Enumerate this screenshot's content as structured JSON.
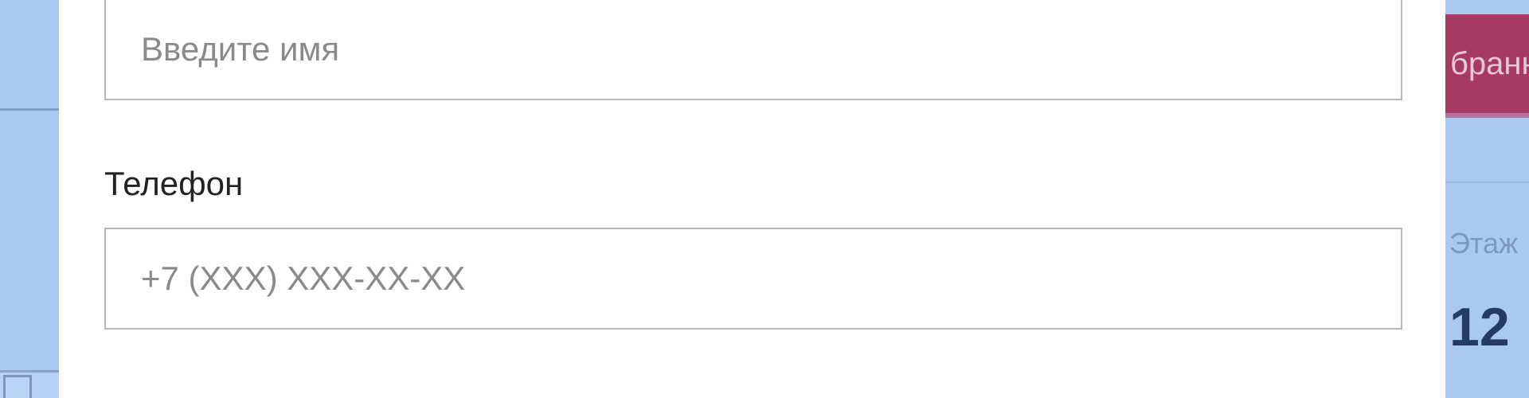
{
  "background": {
    "favorites_button_label": "бранн",
    "floor_label": "Этаж",
    "floor_value": "12",
    "accent_color": "#a63a63"
  },
  "modal": {
    "name_field": {
      "placeholder": "Введите имя",
      "value": ""
    },
    "phone_field": {
      "label": "Телефон",
      "placeholder": "+7 (XXX) XXX-XX-XX",
      "value": ""
    }
  }
}
